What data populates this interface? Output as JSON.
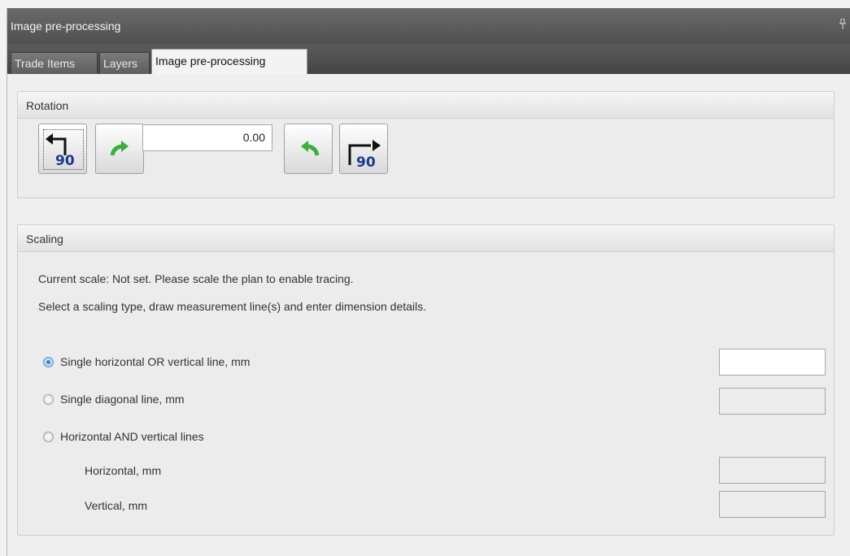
{
  "window": {
    "title": "Image pre-processing",
    "pin_icon": "pin-icon"
  },
  "tabs": [
    {
      "label": "Trade Items",
      "active": false
    },
    {
      "label": "Layers",
      "active": false
    },
    {
      "label": "Image pre-processing",
      "active": true
    }
  ],
  "rotation": {
    "header": "Rotation",
    "angle_value": "0.00",
    "buttons": [
      {
        "name": "rotate-90-ccw",
        "icon": "arrow-left-90-icon",
        "label": "90"
      },
      {
        "name": "rotate-ccw-step",
        "icon": "green-curve-arrow-icon"
      },
      {
        "name": "rotate-cw-step",
        "icon": "green-curve-arrow-icon"
      },
      {
        "name": "rotate-90-cw",
        "icon": "arrow-right-90-icon",
        "label": "90"
      }
    ]
  },
  "scaling": {
    "header": "Scaling",
    "current_scale": "Current scale: Not set. Please scale the plan to enable tracing.",
    "instructions": "Select a scaling type, draw measurement line(s) and enter dimension details.",
    "options": [
      {
        "label": "Single horizontal OR vertical line, mm",
        "checked": true
      },
      {
        "label": "Single diagonal line, mm",
        "checked": false
      },
      {
        "label": "Horizontal AND vertical lines",
        "checked": false
      }
    ],
    "horizontal_label": "Horizontal, mm",
    "vertical_label": "Vertical, mm",
    "inputs": {
      "single_line": "",
      "diagonal": "",
      "horizontal": "",
      "vertical": ""
    }
  },
  "colors": {
    "title_bar": "#5a5a5a",
    "accent_green": "#3cae3c",
    "label_blue": "#1a3a8c"
  }
}
